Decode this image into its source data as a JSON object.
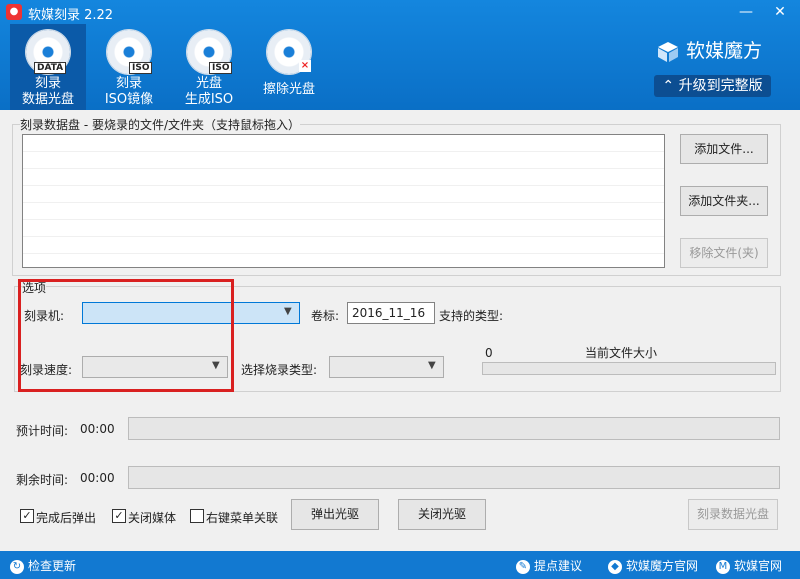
{
  "window": {
    "title": "软媒刻录 2.22",
    "minimize": "—",
    "close": "✕"
  },
  "toolbar": {
    "items": [
      {
        "tag": "DATA",
        "line1": "刻录",
        "line2": "数据光盘"
      },
      {
        "tag": "ISO",
        "line1": "刻录",
        "line2": "ISO镜像"
      },
      {
        "tag": "ISO",
        "line1": "光盘",
        "line2": "生成ISO"
      },
      {
        "tag": "×",
        "line1": "擦除光盘",
        "line2": ""
      }
    ],
    "active_index": 0
  },
  "brand": {
    "name": "软媒魔方",
    "upgrade_label": "升级到完整版"
  },
  "files_group": {
    "title": "刻录数据盘 - 要烧录的文件/文件夹（支持鼠标拖入）",
    "add_file": "添加文件...",
    "add_folder": "添加文件夹...",
    "remove": "移除文件(夹)"
  },
  "options": {
    "title": "选项",
    "burner_label": "刻录机:",
    "burner_value": "",
    "volume_label": "卷标:",
    "volume_value": "2016_11_16",
    "supported_label": "支持的类型:",
    "speed_label": "刻录速度:",
    "burn_type_label": "选择烧录类型:",
    "size_value": "0",
    "size_label": "当前文件大小"
  },
  "progress": {
    "estimated_label": "预计时间:",
    "estimated_value": "00:00",
    "remaining_label": "剩余时间:",
    "remaining_value": "00:00"
  },
  "bottom": {
    "eject_after": {
      "label": "完成后弹出",
      "checked": true
    },
    "close_media": {
      "label": "关闭媒体",
      "checked": true
    },
    "context_menu": {
      "label": "右键菜单关联",
      "checked": false
    },
    "eject_drive": "弹出光驱",
    "close_drive": "关闭光驱",
    "burn_disc": "刻录数据光盘"
  },
  "statusbar": {
    "check_update": "检查更新",
    "suggest": "提点建议",
    "official_site": "软媒魔方官网",
    "ruanmei_site": "软媒官网"
  },
  "colors": {
    "header": "#1486de",
    "status": "#1279d1",
    "highlight": "#d92020"
  }
}
